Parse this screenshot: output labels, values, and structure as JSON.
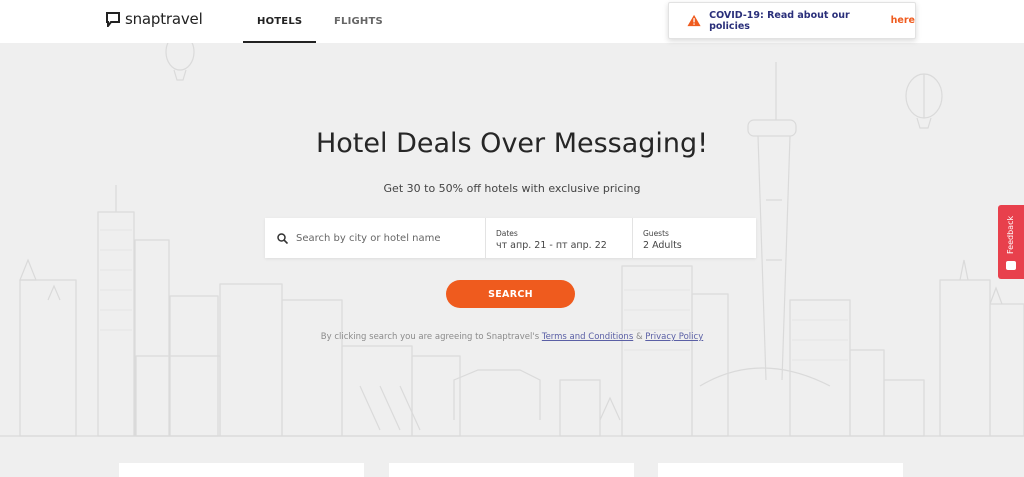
{
  "header": {
    "logo_text": "snaptravel",
    "tabs": [
      {
        "label": "HOTELS",
        "active": true
      },
      {
        "label": "FLIGHTS",
        "active": false
      }
    ]
  },
  "covid_banner": {
    "text": "COVID-19: Read about our policies",
    "link": "here",
    "icon": "warning-icon",
    "icon_color": "#ef5b1e"
  },
  "hero": {
    "title": "Hotel Deals Over Messaging!",
    "subtitle": "Get 30 to 50% off hotels with exclusive pricing"
  },
  "search": {
    "placeholder": "Search by city or hotel name",
    "value": "",
    "dates_label": "Dates",
    "dates_value": "чт апр. 21 - пт апр. 22",
    "guests_label": "Guests",
    "guests_value": "2 Adults",
    "button_label": "SEARCH"
  },
  "terms": {
    "prefix": "By clicking search you are agreeing to Snaptravel's",
    "terms_link": "Terms and Conditions",
    "amp": "&",
    "privacy_link": "Privacy Policy"
  },
  "feedback": {
    "label": "Feedback",
    "color": "#e8404c"
  },
  "colors": {
    "accent": "#ef5b1e",
    "navy": "#2a2f7a"
  }
}
